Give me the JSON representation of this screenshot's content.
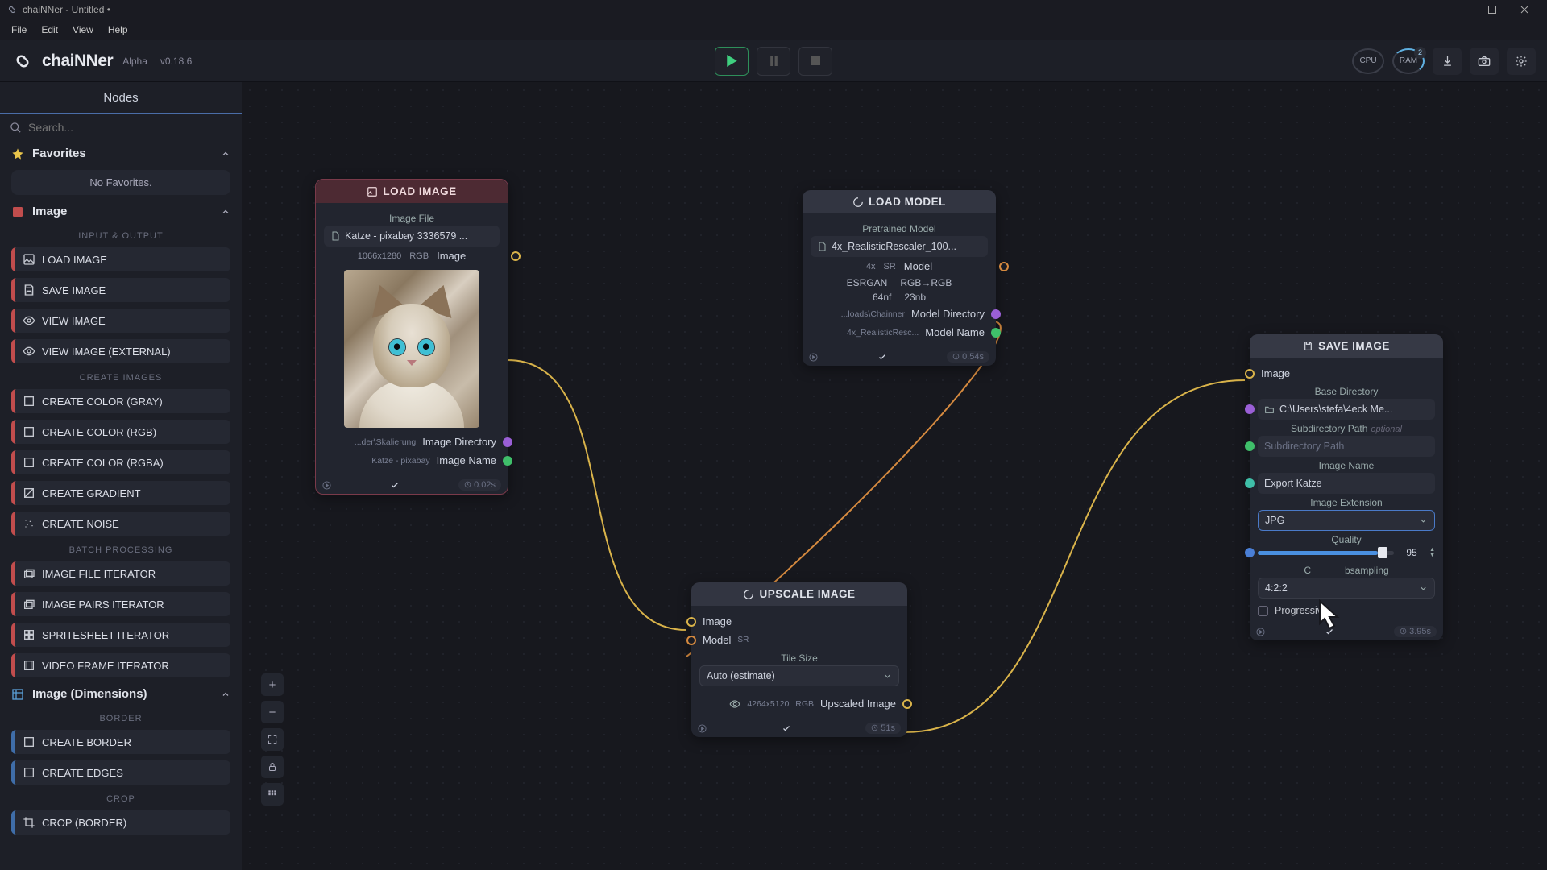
{
  "titlebar": {
    "text": "chaiNNer - Untitled •"
  },
  "menus": [
    "File",
    "Edit",
    "View",
    "Help"
  ],
  "brand": {
    "name": "chaiNNer",
    "label": "Alpha",
    "version": "v0.18.6"
  },
  "header_right": {
    "cpu": "CPU",
    "ram": "RAM",
    "ram_badge": "2"
  },
  "sidebar": {
    "tab": "Nodes",
    "search_placeholder": "Search...",
    "favorites_header": "Favorites",
    "favorites_empty": "No Favorites.",
    "image_section": "Image",
    "cat_io": "INPUT & OUTPUT",
    "items_io": [
      "LOAD IMAGE",
      "SAVE IMAGE",
      "VIEW IMAGE",
      "VIEW IMAGE (EXTERNAL)"
    ],
    "cat_create": "CREATE IMAGES",
    "items_create": [
      "CREATE COLOR (GRAY)",
      "CREATE COLOR (RGB)",
      "CREATE COLOR (RGBA)",
      "CREATE GRADIENT",
      "CREATE NOISE"
    ],
    "cat_batch": "BATCH PROCESSING",
    "items_batch": [
      "IMAGE FILE ITERATOR",
      "IMAGE PAIRS ITERATOR",
      "SPRITESHEET ITERATOR",
      "VIDEO FRAME ITERATOR"
    ],
    "dims_section": "Image (Dimensions)",
    "cat_border": "BORDER",
    "items_border": [
      "CREATE BORDER",
      "CREATE EDGES"
    ],
    "cat_crop": "CROP",
    "items_crop": [
      "CROP (BORDER)"
    ]
  },
  "nodes": {
    "load_image": {
      "title": "LOAD IMAGE",
      "file_label": "Image File",
      "file_value": "Katze - pixabay 3336579 ...",
      "meta_dims": "1066x1280",
      "meta_channels": "RGB",
      "meta_type": "Image",
      "out_dir_small": "...der\\Skalierung",
      "out_dir_label": "Image Directory",
      "out_name_small": "Katze - pixabay",
      "out_name_label": "Image Name",
      "foot_time": "0.02s"
    },
    "load_model": {
      "title": "LOAD MODEL",
      "file_label": "Pretrained Model",
      "file_value": "4x_RealisticRescaler_100...",
      "meta_scale": "4x",
      "meta_type_tag": "SR",
      "meta_type": "Model",
      "info_arch": "ESRGAN",
      "info_ch": "RGB→RGB",
      "info_nf": "64nf",
      "info_nb": "23nb",
      "out_dir_small": "...loads\\Chainner",
      "out_dir_label": "Model Directory",
      "out_name_small": "4x_RealisticResc...",
      "out_name_label": "Model Name",
      "foot_time": "0.54s"
    },
    "upscale": {
      "title": "UPSCALE IMAGE",
      "in_image": "Image",
      "in_model": "Model",
      "in_model_tag": "SR",
      "tile_label": "Tile Size",
      "tile_value": "Auto (estimate)",
      "out_dims": "4264x5120",
      "out_channels": "RGB",
      "out_label": "Upscaled Image",
      "foot_time": "51s"
    },
    "save_image": {
      "title": "SAVE IMAGE",
      "in_image_label": "Image",
      "basedir_label": "Base Directory",
      "basedir_value": "C:\\Users\\stefa\\4eck Me...",
      "subdir_label": "Subdirectory Path",
      "subdir_opt": "optional",
      "subdir_placeholder": "Subdirectory Path",
      "name_label": "Image Name",
      "name_value": "Export Katze",
      "ext_label": "Image Extension",
      "ext_value": "JPG",
      "quality_label": "Quality",
      "quality_value": "95",
      "subsampling_fragment": "bsampling",
      "subsampling_prefix": "C",
      "subsample_value": "4:2:2",
      "progressive_label": "Progressive",
      "foot_time": "3.95s"
    }
  }
}
